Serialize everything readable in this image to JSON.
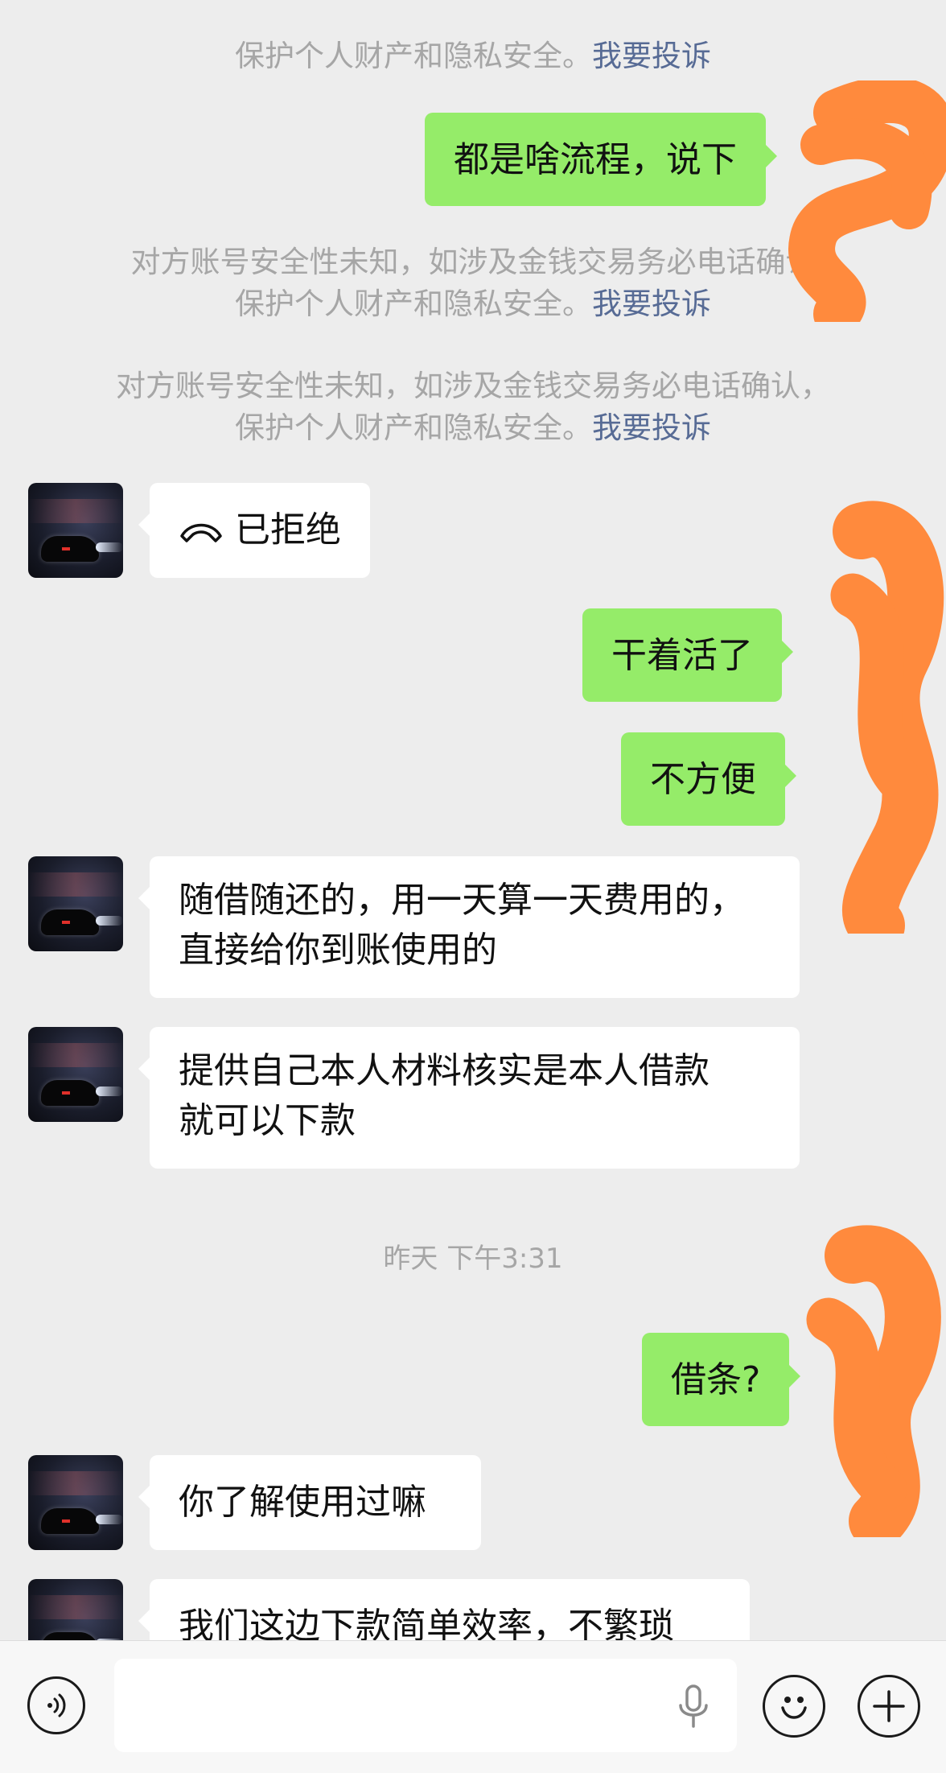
{
  "system_notices": {
    "warning_line": "对方账号安全性未知，如涉及金钱交易务必电话确认，",
    "warning_line_partial": "对方账号安全性未知，如涉及金钱交易务必电话确认",
    "protect_line": "保护个人财产和隐私安全。",
    "complaint_link": "我要投诉"
  },
  "messages": [
    {
      "side": "out",
      "text": "都是啥流程，说下"
    },
    {
      "side": "in",
      "icon": "hangup-icon",
      "text": "已拒绝"
    },
    {
      "side": "out",
      "text": "干着活了"
    },
    {
      "side": "out",
      "text": "不方便"
    },
    {
      "side": "in",
      "line1": "随借随还的，用一天算一天费用的，",
      "line2": "直接给你到账使用的"
    },
    {
      "side": "in",
      "line1": "提供自己本人材料核实是本人借款",
      "line2": "就可以下款"
    },
    {
      "side": "out",
      "text": "借条?"
    },
    {
      "side": "in",
      "text": "你了解使用过嘛"
    },
    {
      "side": "in",
      "text": "我们这边下款简单效率，不繁琐"
    }
  ],
  "timestamp": "昨天 下午3:31",
  "input_bar": {
    "voice_icon": "voice-icon",
    "mic_icon": "microphone-icon",
    "emoji_icon": "emoji-icon",
    "more_icon": "plus-icon",
    "input_value": ""
  },
  "colors": {
    "background": "#EDEDED",
    "out_bubble": "#95EC69",
    "in_bubble": "#FFFFFF",
    "link": "#576B95",
    "redaction": "#FF8A3D"
  }
}
